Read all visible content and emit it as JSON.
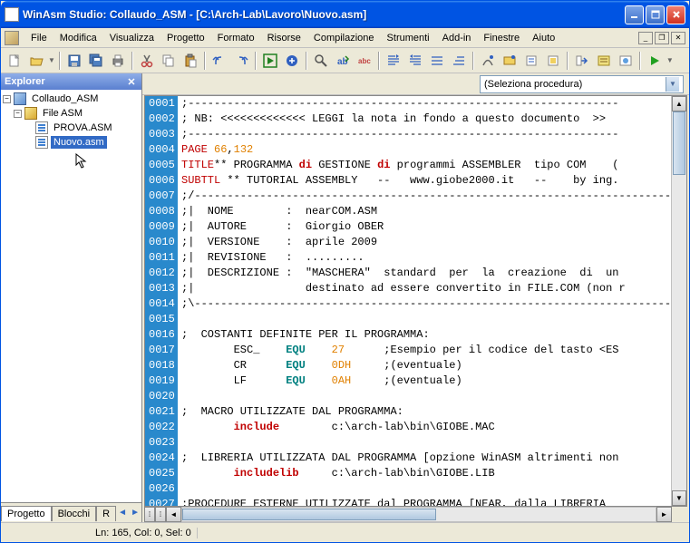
{
  "window": {
    "title": "WinAsm Studio: Collaudo_ASM - [C:\\Arch-Lab\\Lavoro\\Nuovo.asm]"
  },
  "menu": [
    "File",
    "Modifica",
    "Visualizza",
    "Progetto",
    "Formato",
    "Risorse",
    "Compilazione",
    "Strumenti",
    "Add-in",
    "Finestre",
    "Aiuto"
  ],
  "explorer": {
    "title": "Explorer",
    "project": "Collaudo_ASM",
    "folder": "File ASM",
    "files": [
      "PROVA.ASM",
      "Nuovo.asm"
    ],
    "selected": "Nuovo.asm",
    "tabs": [
      "Progetto",
      "Blocchi",
      "R"
    ]
  },
  "proc_combo": "(Seleziona procedura)",
  "status": {
    "pos": "Ln: 165, Col: 0, Sel: 0"
  },
  "code": {
    "first_line": 1,
    "lines": [
      {
        "t": ";------------------------------------------------------------------"
      },
      {
        "segs": [
          {
            "t": "; NB: <<<<<<<<<<<<< LEGGI la nota in fondo a questo documento  >>"
          }
        ]
      },
      {
        "t": ";------------------------------------------------------------------"
      },
      {
        "segs": [
          {
            "t": "PAGE",
            "c": "kw-red"
          },
          {
            "t": " "
          },
          {
            "t": "66",
            "c": "kw-orange"
          },
          {
            "t": ","
          },
          {
            "t": "132",
            "c": "kw-orange"
          }
        ]
      },
      {
        "segs": [
          {
            "t": "TITLE",
            "c": "kw-red"
          },
          {
            "t": "** PROGRAMMA "
          },
          {
            "t": "di",
            "c": "kw-redb"
          },
          {
            "t": " GESTIONE "
          },
          {
            "t": "di",
            "c": "kw-redb"
          },
          {
            "t": " programmi ASSEMBLER  tipo COM    ("
          }
        ]
      },
      {
        "segs": [
          {
            "t": "SUBTTL",
            "c": "kw-red"
          },
          {
            "t": " ** TUTORIAL ASSEMBLY   --   www.giobe2000.it   --    by ing."
          }
        ]
      },
      {
        "t": ";/---------------------------------------------------------------------------"
      },
      {
        "t": ";|  NOME        :  nearCOM.ASM"
      },
      {
        "t": ";|  AUTORE      :  Giorgio OBER"
      },
      {
        "t": ";|  VERSIONE    :  aprile 2009"
      },
      {
        "t": ";|  REVISIONE   :  ........."
      },
      {
        "t": ";|  DESCRIZIONE :  \"MASCHERA\"  standard  per  la  creazione  di  un"
      },
      {
        "t": ";|                 destinato ad essere convertito in FILE.COM (non r"
      },
      {
        "t": ";\\---------------------------------------------------------------------------"
      },
      {
        "t": ""
      },
      {
        "t": ";  COSTANTI DEFINITE PER IL PROGRAMMA:"
      },
      {
        "segs": [
          {
            "t": "        ESC_    "
          },
          {
            "t": "EQU",
            "c": "kw-teal"
          },
          {
            "t": "    "
          },
          {
            "t": "27",
            "c": "kw-orange"
          },
          {
            "t": "      ;Esempio per il codice del tasto <ES"
          }
        ]
      },
      {
        "segs": [
          {
            "t": "        CR      "
          },
          {
            "t": "EQU",
            "c": "kw-teal"
          },
          {
            "t": "    "
          },
          {
            "t": "0DH",
            "c": "kw-orange"
          },
          {
            "t": "     ;(eventuale)"
          }
        ]
      },
      {
        "segs": [
          {
            "t": "        LF      "
          },
          {
            "t": "EQU",
            "c": "kw-teal"
          },
          {
            "t": "    "
          },
          {
            "t": "0AH",
            "c": "kw-orange"
          },
          {
            "t": "     ;(eventuale)"
          }
        ]
      },
      {
        "t": ""
      },
      {
        "t": ";  MACRO UTILIZZATE DAL PROGRAMMA:"
      },
      {
        "segs": [
          {
            "t": "        "
          },
          {
            "t": "include",
            "c": "kw-redb"
          },
          {
            "t": "        c:\\arch-lab\\bin\\GIOBE.MAC"
          }
        ]
      },
      {
        "t": ""
      },
      {
        "t": ";  LIBRERIA UTILIZZATA DAL PROGRAMMA [opzione WinASM altrimenti non"
      },
      {
        "segs": [
          {
            "t": "        "
          },
          {
            "t": "includelib",
            "c": "kw-redb"
          },
          {
            "t": "     c:\\arch-lab\\bin\\GIOBE.LIB"
          }
        ]
      },
      {
        "t": ""
      },
      {
        "t": ";PROCEDURE ESTERNE UTILIZZATE dal PROGRAMMA [NEAR, dalla LIBRERIA"
      },
      {
        "t": ""
      }
    ]
  }
}
